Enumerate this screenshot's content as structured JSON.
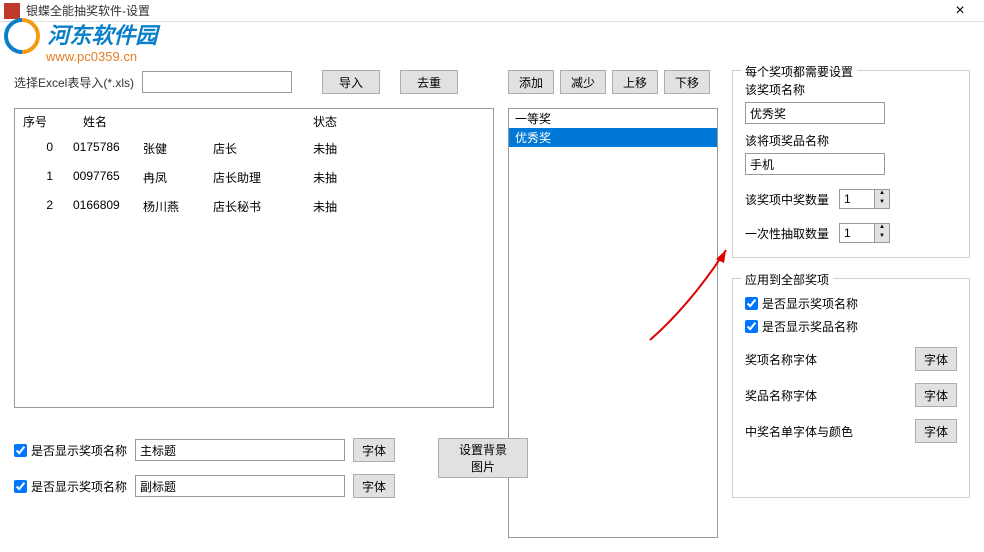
{
  "window": {
    "title": "银蝶全能抽奖软件-设置",
    "close": "×"
  },
  "watermark": {
    "site_name": "河东软件园",
    "url": "www.pc0359.cn"
  },
  "import": {
    "label": "选择Excel表导入(*.xls)",
    "path": "",
    "import_btn": "导入",
    "dedupe_btn": "去重"
  },
  "table": {
    "headers": {
      "idx": "序号",
      "name": "姓名",
      "status": "状态"
    },
    "rows": [
      {
        "idx": "0",
        "id": "0175786",
        "name": "张健",
        "role": "店长",
        "status": "未抽"
      },
      {
        "idx": "1",
        "id": "0097765",
        "name": "冉凤",
        "role": "店长助理",
        "status": "未抽"
      },
      {
        "idx": "2",
        "id": "0166809",
        "name": "杨川燕",
        "role": "店长秘书",
        "status": "未抽"
      }
    ]
  },
  "display_opts": {
    "show_prize_name_label": "是否显示奖项名称",
    "main_title": "主标题",
    "sub_title": "副标题",
    "font_btn": "字体"
  },
  "mid": {
    "add_btn": "添加",
    "remove_btn": "减少",
    "up_btn": "上移",
    "down_btn": "下移",
    "items": [
      "一等奖",
      "优秀奖"
    ],
    "selected_index": 1
  },
  "bg_btn": "设置背景图片",
  "prize_settings": {
    "legend": "每个奖项都需要设置",
    "name_label": "该奖项名称",
    "name_value": "优秀奖",
    "item_label": "该将项奖品名称",
    "item_value": "手机",
    "win_count_label": "该奖项中奖数量",
    "win_count_value": "1",
    "draw_count_label": "一次性抽取数量",
    "draw_count_value": "1"
  },
  "global_settings": {
    "legend": "应用到全部奖项",
    "show_prize_name": "是否显示奖项名称",
    "show_item_name": "是否显示奖品名称",
    "prize_font_label": "奖项名称字体",
    "item_font_label": "奖品名称字体",
    "winner_font_label": "中奖名单字体与颜色",
    "font_btn": "字体"
  }
}
